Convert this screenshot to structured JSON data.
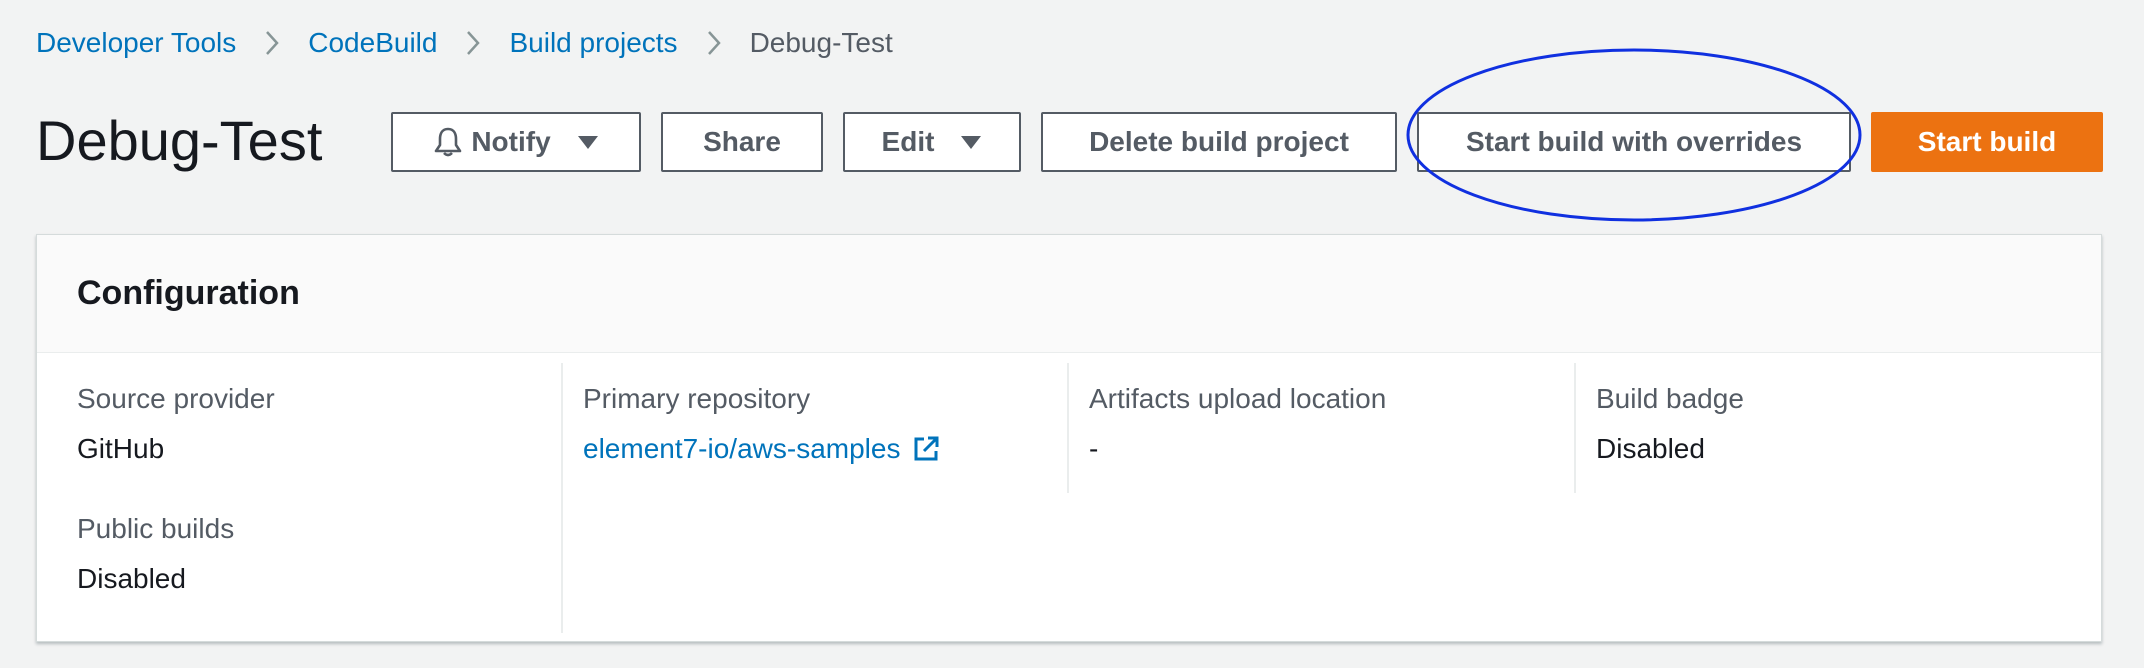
{
  "breadcrumb": {
    "items": [
      "Developer Tools",
      "CodeBuild",
      "Build projects"
    ],
    "current": "Debug-Test"
  },
  "header": {
    "title": "Debug-Test",
    "buttons": {
      "notify": "Notify",
      "share": "Share",
      "edit": "Edit",
      "delete": "Delete build project",
      "start_overrides": "Start build with overrides",
      "start": "Start build"
    }
  },
  "configuration": {
    "title": "Configuration",
    "source_provider_label": "Source provider",
    "source_provider_value": "GitHub",
    "public_builds_label": "Public builds",
    "public_builds_value": "Disabled",
    "primary_repository_label": "Primary repository",
    "primary_repository_value": "element7-io/aws-samples",
    "artifacts_label": "Artifacts upload location",
    "artifacts_value": "-",
    "build_badge_label": "Build badge",
    "build_badge_value": "Disabled"
  },
  "icons": {
    "breadcrumb_separator": "chevron-right-icon",
    "notify": "bell-icon",
    "dropdown": "caret-down-icon",
    "external_link": "external-link-icon"
  },
  "colors": {
    "link": "#0073bb",
    "primary_button": "#ec7211",
    "annotation": "#1030e0",
    "background": "#f2f3f3"
  }
}
